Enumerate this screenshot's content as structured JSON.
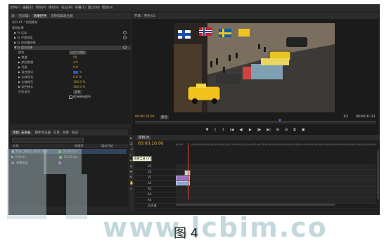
{
  "menubar": {
    "items": [
      "文件(F)",
      "编辑(E)",
      "项目(P)",
      "序列(S)",
      "标记(M)",
      "字幕(T)",
      "窗口(W)",
      "帮助(H)"
    ]
  },
  "effect_controls": {
    "tabs": [
      "源：(无剪辑)",
      "效果控件",
      "音频剪辑混合器"
    ],
    "header": "序列 01 * 视频素材",
    "rows": [
      {
        "label": "视频效果",
        "value": ""
      },
      {
        "label": "▶ fx 运动",
        "value": ""
      },
      {
        "label": "▶ fx 不透明度",
        "value": ""
      },
      {
        "label": "▶ fx 时间重映射",
        "value": ""
      },
      {
        "label": "▼ fx 裁剪效果",
        "value": ""
      },
      {
        "label": "颜色",
        "value": "自定义颜色"
      },
      {
        "label": "▶ 数量",
        "value": "50"
      },
      {
        "label": "▶ 颜色数量",
        "value": "4.0"
      },
      {
        "label": "▶ 亮度",
        "value": "0.0"
      },
      {
        "label": "▶ 混合模式",
        "value": ""
      },
      {
        "label": "▶ 边缘羽化",
        "value": "0.0 %"
      },
      {
        "label": "▶ 边缘颜色",
        "value": "100.0 %"
      },
      {
        "label": "▶ 颜色模式",
        "value": "100.0 %"
      },
      {
        "label": "色彩混合",
        "value": "混合"
      },
      {
        "label": "",
        "value": "保持原始颜色"
      }
    ]
  },
  "program_monitor": {
    "tab": "节目：序列 01",
    "timecode_left": "00:00:10:00",
    "fit_label": "适合",
    "page_label": "1/2",
    "timecode_right": "00:00:31:23",
    "transport": [
      "▼",
      "{",
      "}",
      "|◀",
      "◀|",
      "▶",
      "|▶",
      "▶|",
      "⊞",
      "⊟",
      "⧉",
      "▣"
    ]
  },
  "project": {
    "tabs": [
      "项目: 未命名",
      "媒体浏览器",
      "信息",
      "效果",
      "标记"
    ],
    "search_placeholder": "",
    "columns": [
      "名称",
      "帧速率",
      "媒体开始"
    ],
    "items": [
      {
        "name": "DSC_0002_0187.mov",
        "color": "#4da34d",
        "fps": "25.00 fps"
      },
      {
        "name": "序列 01",
        "color": "#4da34d",
        "fps": "25.00 fps"
      },
      {
        "name": "调整图层",
        "color": "#b04db0",
        "fps": ""
      }
    ]
  },
  "tools": {
    "tooltip": "选择工具 (V)"
  },
  "timeline": {
    "tab": "序列 01",
    "timecode": "00:00:10:00",
    "ruler": [
      "00:00",
      "00:00:05:00",
      "00:00:10:00",
      "00:00:15:00",
      "00:00:20:00",
      "00:00:25:00",
      "00:00:30:00",
      "00:00:35:00",
      "00:00:40:00",
      "00:00:45:00",
      "00:00:50:00",
      "00:00:55:00",
      "00:01:00:00"
    ],
    "tracks": [
      "V3",
      "V2",
      "V1",
      "A1",
      "A2",
      "A3",
      "A4",
      "主声道"
    ],
    "clip_v": "调整图层",
    "clip_a": ""
  },
  "watermark": {
    "text": "www.lcbim.co"
  },
  "caption": "图 4"
}
